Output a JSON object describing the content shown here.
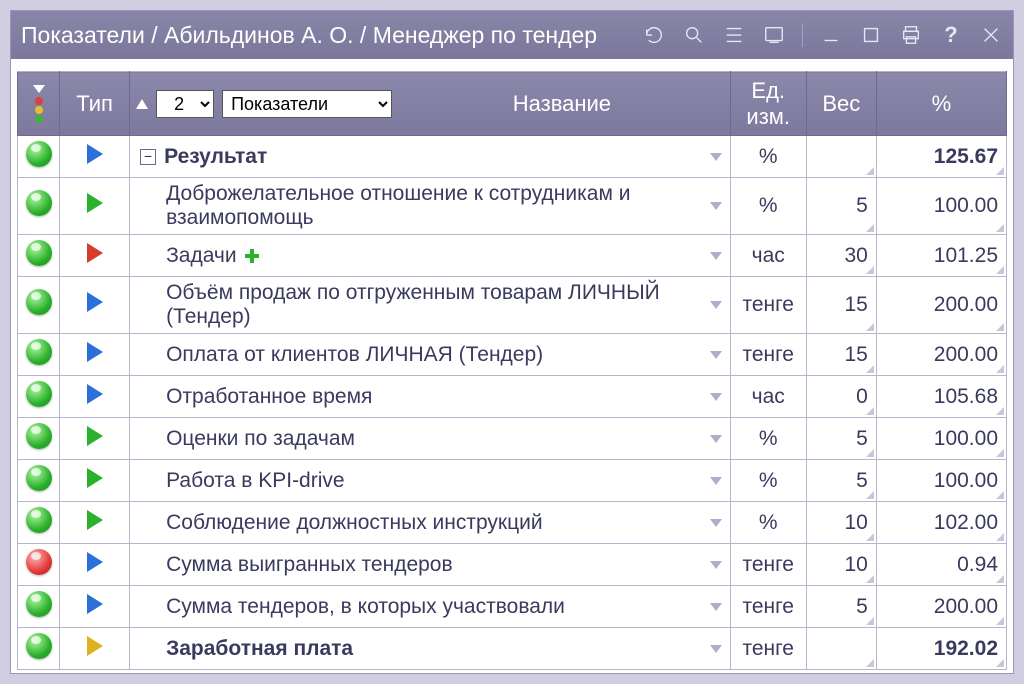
{
  "titlebar": {
    "text": "Показатели / Абильдинов А. О. / Менеджер по тендер"
  },
  "header": {
    "type": "Тип",
    "level_value": "2",
    "category_value": "Показатели",
    "name": "Название",
    "unit": "Ед. изм.",
    "weight": "Вес",
    "percent": "%"
  },
  "rows": [
    {
      "status": "green",
      "type": "blue",
      "indent": 0,
      "expand": "−",
      "name": "Результат",
      "bold": true,
      "plus": false,
      "unit": "%",
      "weight": "",
      "pct": "125.67",
      "tall": false
    },
    {
      "status": "green",
      "type": "green",
      "indent": 1,
      "expand": "",
      "name": "Доброжелательное отношение к сотрудникам и взаимопомощь",
      "bold": false,
      "plus": false,
      "unit": "%",
      "weight": "5",
      "pct": "100.00",
      "tall": true
    },
    {
      "status": "green",
      "type": "red",
      "indent": 1,
      "expand": "",
      "name": "Задачи",
      "bold": false,
      "plus": true,
      "unit": "час",
      "weight": "30",
      "pct": "101.25",
      "tall": false
    },
    {
      "status": "green",
      "type": "blue",
      "indent": 1,
      "expand": "",
      "name": "Объём продаж по отгруженным товарам ЛИЧНЫЙ (Тендер)",
      "bold": false,
      "plus": false,
      "unit": "тенге",
      "weight": "15",
      "pct": "200.00",
      "tall": true
    },
    {
      "status": "green",
      "type": "blue",
      "indent": 1,
      "expand": "",
      "name": "Оплата от клиентов ЛИЧНАЯ (Тендер)",
      "bold": false,
      "plus": false,
      "unit": "тенге",
      "weight": "15",
      "pct": "200.00",
      "tall": false
    },
    {
      "status": "green",
      "type": "blue",
      "indent": 1,
      "expand": "",
      "name": "Отработанное время",
      "bold": false,
      "plus": false,
      "unit": "час",
      "weight": "0",
      "pct": "105.68",
      "tall": false
    },
    {
      "status": "green",
      "type": "green",
      "indent": 1,
      "expand": "",
      "name": "Оценки по задачам",
      "bold": false,
      "plus": false,
      "unit": "%",
      "weight": "5",
      "pct": "100.00",
      "tall": false
    },
    {
      "status": "green",
      "type": "green",
      "indent": 1,
      "expand": "",
      "name": "Работа в KPI-drive",
      "bold": false,
      "plus": false,
      "unit": "%",
      "weight": "5",
      "pct": "100.00",
      "tall": false
    },
    {
      "status": "green",
      "type": "green",
      "indent": 1,
      "expand": "",
      "name": "Соблюдение должностных инструкций",
      "bold": false,
      "plus": false,
      "unit": "%",
      "weight": "10",
      "pct": "102.00",
      "tall": false
    },
    {
      "status": "red",
      "type": "blue",
      "indent": 1,
      "expand": "",
      "name": "Сумма выигранных тендеров",
      "bold": false,
      "plus": false,
      "unit": "тенге",
      "weight": "10",
      "pct": "0.94",
      "tall": false
    },
    {
      "status": "green",
      "type": "blue",
      "indent": 1,
      "expand": "",
      "name": "Сумма тендеров, в которых участвовали",
      "bold": false,
      "plus": false,
      "unit": "тенге",
      "weight": "5",
      "pct": "200.00",
      "tall": false
    },
    {
      "status": "green",
      "type": "yellow",
      "indent": 1,
      "expand": "",
      "name": "Заработная плата",
      "bold": true,
      "plus": false,
      "unit": "тенге",
      "weight": "",
      "pct": "192.02",
      "tall": false
    }
  ]
}
